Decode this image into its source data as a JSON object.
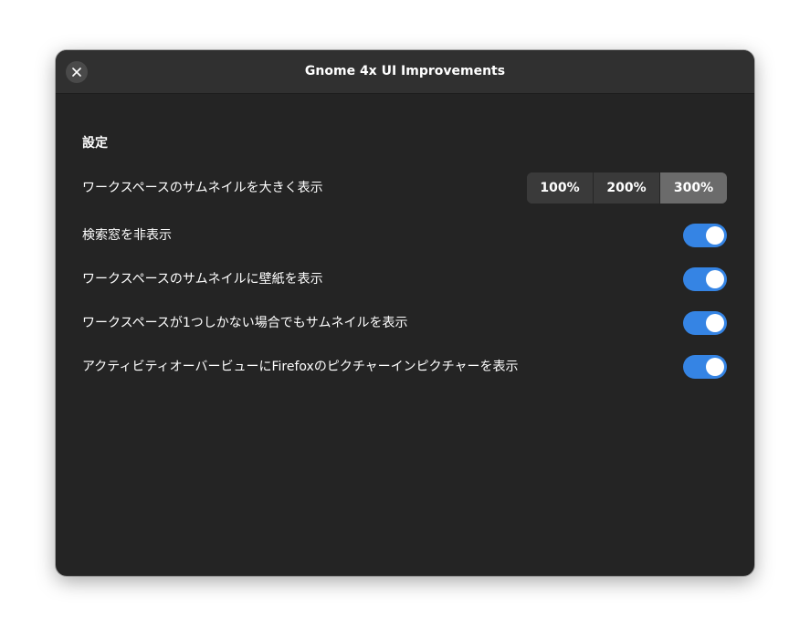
{
  "window": {
    "title": "Gnome 4x UI Improvements"
  },
  "settings": {
    "heading": "設定",
    "thumbnail_size": {
      "label": "ワークスペースのサムネイルを大きく表示",
      "options": [
        "100%",
        "200%",
        "300%"
      ],
      "selected": "300%"
    },
    "toggles": [
      {
        "label": "検索窓を非表示",
        "enabled": true
      },
      {
        "label": "ワークスペースのサムネイルに壁紙を表示",
        "enabled": true
      },
      {
        "label": "ワークスペースが1つしかない場合でもサムネイルを表示",
        "enabled": true
      },
      {
        "label": "アクティビティオーバービューにFirefoxのピクチャーインピクチャーを表示",
        "enabled": true
      }
    ]
  },
  "colors": {
    "accent": "#3584e4",
    "window_bg": "#242424",
    "titlebar_bg": "#303030"
  },
  "icons": {
    "close": "close-icon"
  }
}
